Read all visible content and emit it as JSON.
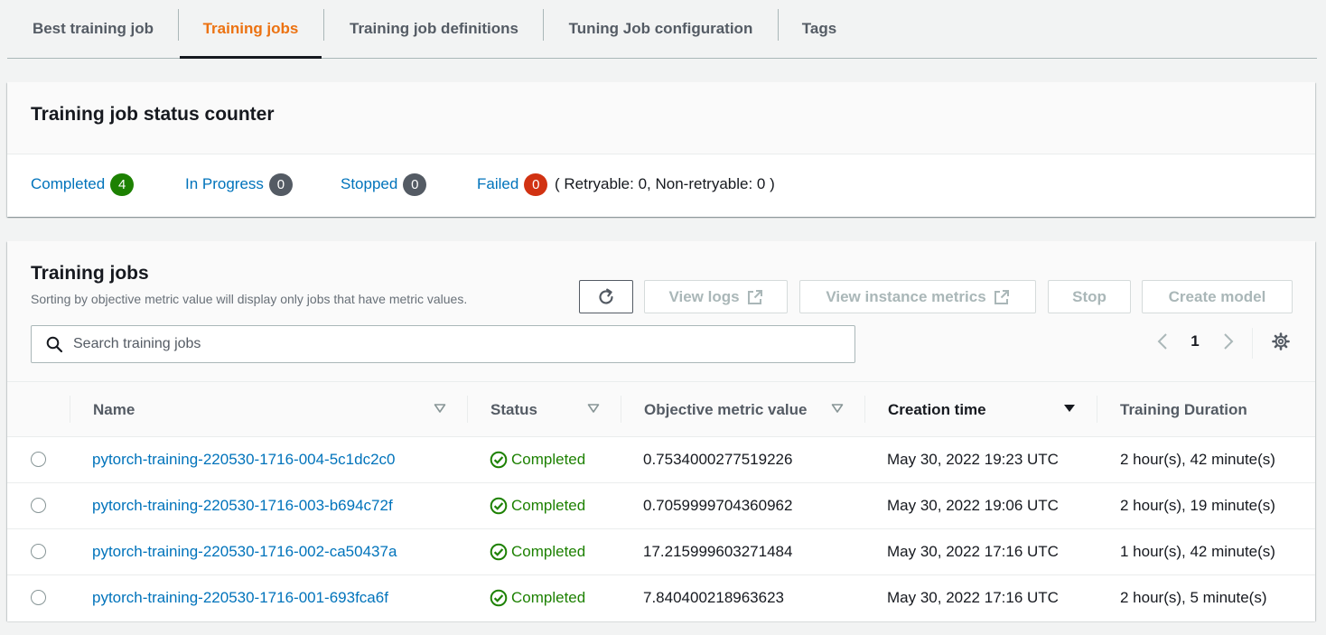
{
  "tabs": [
    {
      "label": "Best training job"
    },
    {
      "label": "Training jobs"
    },
    {
      "label": "Training job definitions"
    },
    {
      "label": "Tuning Job configuration"
    },
    {
      "label": "Tags"
    }
  ],
  "status_counter": {
    "title": "Training job status counter",
    "completed_label": "Completed",
    "completed_count": "4",
    "in_progress_label": "In Progress",
    "in_progress_count": "0",
    "stopped_label": "Stopped",
    "stopped_count": "0",
    "failed_label": "Failed",
    "failed_count": "0",
    "retry_note": "( Retryable: 0, Non-retryable: 0 )"
  },
  "training_jobs": {
    "title": "Training jobs",
    "description": "Sorting by objective metric value will display only jobs that have metric values.",
    "buttons": {
      "view_logs": "View logs",
      "view_instance_metrics": "View instance metrics",
      "stop": "Stop",
      "create_model": "Create model"
    },
    "search_placeholder": "Search training jobs",
    "page": "1",
    "columns": {
      "name": "Name",
      "status": "Status",
      "metric": "Objective metric value",
      "creation": "Creation time",
      "duration": "Training Duration"
    },
    "rows": [
      {
        "name": "pytorch-training-220530-1716-004-5c1dc2c0",
        "status": "Completed",
        "metric": "0.7534000277519226",
        "creation": "May 30, 2022 19:23 UTC",
        "duration": "2 hour(s), 42 minute(s)"
      },
      {
        "name": "pytorch-training-220530-1716-003-b694c72f",
        "status": "Completed",
        "metric": "0.7059999704360962",
        "creation": "May 30, 2022 19:06 UTC",
        "duration": "2 hour(s), 19 minute(s)"
      },
      {
        "name": "pytorch-training-220530-1716-002-ca50437a",
        "status": "Completed",
        "metric": "17.215999603271484",
        "creation": "May 30, 2022 17:16 UTC",
        "duration": "1 hour(s), 42 minute(s)"
      },
      {
        "name": "pytorch-training-220530-1716-001-693fca6f",
        "status": "Completed",
        "metric": "7.840400218963623",
        "creation": "May 30, 2022 17:16 UTC",
        "duration": "2 hour(s), 5 minute(s)"
      }
    ]
  },
  "colors": {
    "active_tab": "#ec7211",
    "link": "#0073bb",
    "success": "#1d8102",
    "error": "#d13212"
  }
}
